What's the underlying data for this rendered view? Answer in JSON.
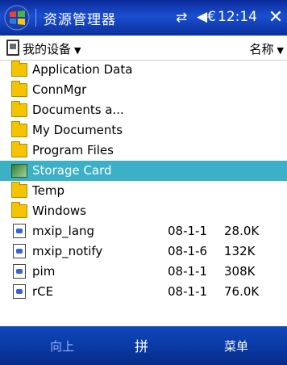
{
  "titlebar": {
    "title": "资源管理器",
    "time": "12:14",
    "close_label": "✕",
    "conn_icon": "⇄",
    "volume_icon": "◀€"
  },
  "header": {
    "location": "我的设备",
    "sort": "名称"
  },
  "items": [
    {
      "name": "Application Data",
      "type": "folder",
      "date": "",
      "size": ""
    },
    {
      "name": "ConnMgr",
      "type": "folder",
      "date": "",
      "size": ""
    },
    {
      "name": "Documents a...",
      "type": "folder",
      "date": "",
      "size": ""
    },
    {
      "name": "My Documents",
      "type": "folder",
      "date": "",
      "size": ""
    },
    {
      "name": "Program Files",
      "type": "folder",
      "date": "",
      "size": ""
    },
    {
      "name": "Storage Card",
      "type": "storage-card",
      "date": "",
      "size": "",
      "selected": true
    },
    {
      "name": "Temp",
      "type": "folder",
      "date": "",
      "size": ""
    },
    {
      "name": "Windows",
      "type": "folder",
      "date": "",
      "size": ""
    },
    {
      "name": "mxip_lang",
      "type": "file",
      "date": "08-1-1",
      "size": "28.0K"
    },
    {
      "name": "mxip_notify",
      "type": "file",
      "date": "08-1-6",
      "size": "132K"
    },
    {
      "name": "pim",
      "type": "file",
      "date": "08-1-1",
      "size": "308K"
    },
    {
      "name": "rCE",
      "type": "file",
      "date": "08-1-1",
      "size": "76.0K"
    }
  ],
  "menubar": {
    "left": "向上",
    "ime": "拼",
    "right": "菜单"
  },
  "colors": {
    "titlebar": "#1a4fd0",
    "selection": "#3bb0c6",
    "folder": "#f5c400",
    "menubar": "#0a3aa6"
  }
}
